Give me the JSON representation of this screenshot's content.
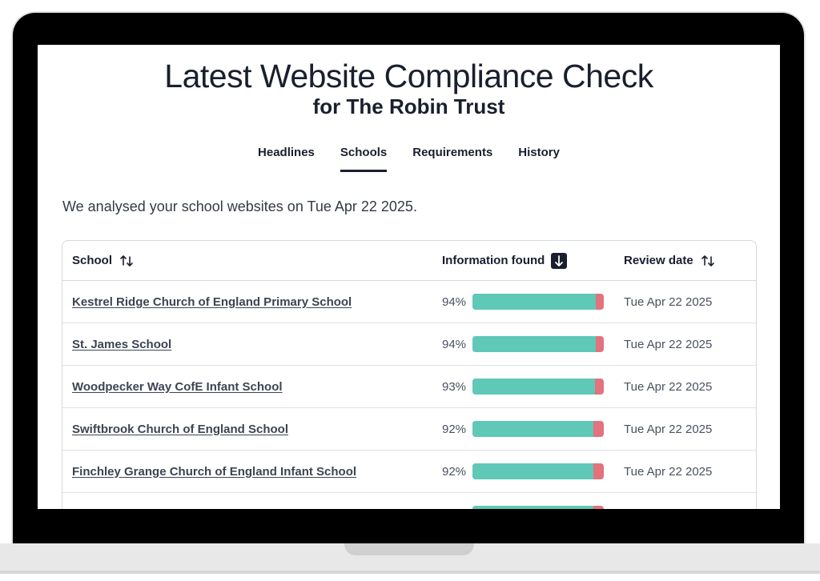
{
  "header": {
    "title": "Latest Website Compliance Check",
    "subtitle": "for The Robin Trust"
  },
  "tabs": [
    {
      "label": "Headlines",
      "active": false
    },
    {
      "label": "Schools",
      "active": true
    },
    {
      "label": "Requirements",
      "active": false
    },
    {
      "label": "History",
      "active": false
    }
  ],
  "intro": "We analysed your school websites on Tue Apr 22 2025.",
  "table": {
    "columns": {
      "school": "School",
      "info": "Information found",
      "date": "Review date"
    },
    "rows": [
      {
        "school": "Kestrel Ridge Church of England Primary School",
        "percent": "94%",
        "fraction": 0.94,
        "date": "Tue Apr 22 2025"
      },
      {
        "school": "St. James School",
        "percent": "94%",
        "fraction": 0.94,
        "date": "Tue Apr 22 2025"
      },
      {
        "school": "Woodpecker Way CofE Infant School",
        "percent": "93%",
        "fraction": 0.93,
        "date": "Tue Apr 22 2025"
      },
      {
        "school": "Swiftbrook Church of England School",
        "percent": "92%",
        "fraction": 0.92,
        "date": "Tue Apr 22 2025"
      },
      {
        "school": "Finchley Grange Church of England Infant School",
        "percent": "92%",
        "fraction": 0.92,
        "date": "Tue Apr 22 2025"
      },
      {
        "school": "",
        "percent": "",
        "fraction": 0.92,
        "date": ""
      }
    ]
  },
  "colors": {
    "found": "#5fc8b7",
    "missing": "#e2727e",
    "text": "#1a1f2e"
  },
  "icons": {
    "sort_default": "sort-updown-icon",
    "sort_active": "arrow-down-icon"
  }
}
